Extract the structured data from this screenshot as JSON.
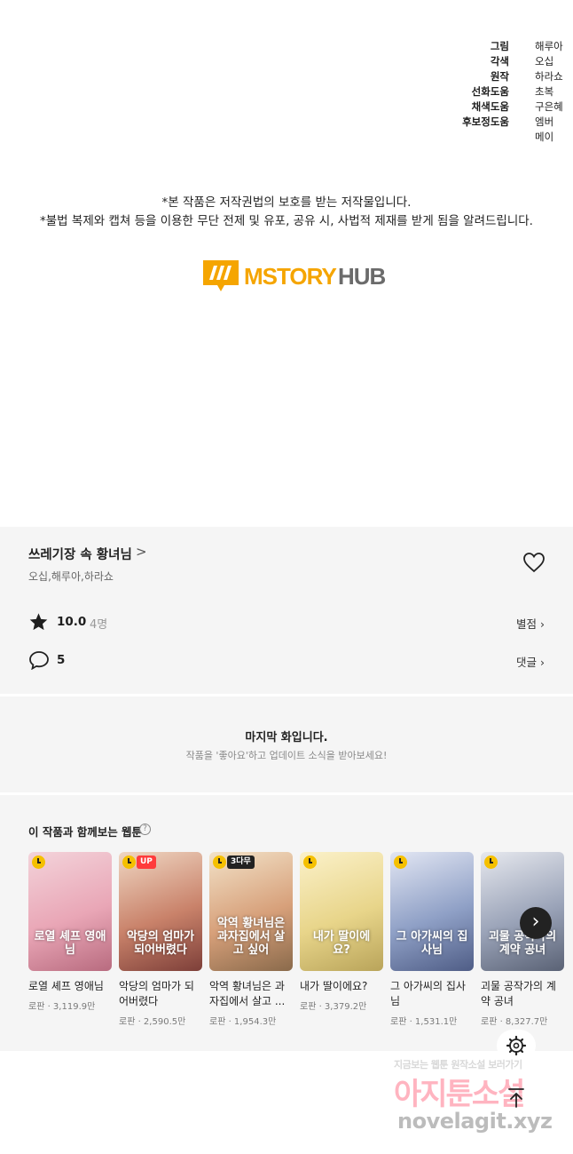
{
  "credits": [
    {
      "role": "그림",
      "name": "해루아"
    },
    {
      "role": "각색",
      "name": "오십"
    },
    {
      "role": "원작",
      "name": "하라쇼"
    },
    {
      "role": "선화도움",
      "name": "초복"
    },
    {
      "role": "채색도움",
      "name": "구은혜"
    },
    {
      "role": "후보정도움",
      "name": "엠버"
    },
    {
      "role": "",
      "name": "메이"
    }
  ],
  "notice": {
    "line1": "*본 작품은 저작권법의 보호를 받는 저작물입니다.",
    "line2": "*불법 복제와 캡쳐 등을 이용한 무단 전제 및 유포, 공유 시, 사법적 제재를 받게 됨을 알려드립니다."
  },
  "logo": {
    "text_main": "MSTORY",
    "text_hub": "HUB",
    "colors": {
      "accent": "#f5a500",
      "text": "#6b6b6b"
    }
  },
  "series": {
    "title": "쓰레기장 속 황녀님",
    "arrow": ">",
    "authors": "오십,해루아,하라쇼",
    "rating": "10.0",
    "rating_count": "4명",
    "rate_label": "별점",
    "comment_count": "5",
    "comment_label": "댓글"
  },
  "last_episode": {
    "title": "마지막 화입니다.",
    "subtitle": "작품을 '좋아요'하고 업데이트 소식을 받아보세요!"
  },
  "recommendations": {
    "title": "이 작품과 함께보는 웹툰",
    "help": "?",
    "items": [
      {
        "title": "로열 셰프 영애님",
        "meta": "로판 · 3,119.9만",
        "badge": "",
        "cover_text": "로열 셰프 영애님",
        "color": "#e9a6b6"
      },
      {
        "title": "악당의 엄마가 되어버렸다",
        "meta": "로판 · 2,590.5만",
        "badge": "UP",
        "cover_text": "악당의 엄마가 되어버렸다",
        "color": "#c9826a"
      },
      {
        "title": "악역 황녀님은 과자집에서 살고 ...",
        "meta": "로판 · 1,954.3만",
        "badge": "3다무",
        "cover_text": "악역 황녀님은 과자집에서 살고 싶어",
        "color": "#d7a07a"
      },
      {
        "title": "내가 딸이에요?",
        "meta": "로판 · 3,379.2만",
        "badge": "",
        "cover_text": "내가 딸이에요?",
        "color": "#e8d58a"
      },
      {
        "title": "그 아가씨의 집사님",
        "meta": "로판 · 1,531.1만",
        "badge": "",
        "cover_text": "그 아가씨의 집사님",
        "color": "#8fa0c6"
      },
      {
        "title": "괴물 공작가의 계약 공녀",
        "meta": "로판 · 8,327.7만",
        "badge": "",
        "cover_text": "괴물 공작가의 계약 공녀",
        "color": "#9aa3b8"
      }
    ]
  },
  "watermark": {
    "line1": "지금보는 웹툰 원작소설 보러가기",
    "line2": "아지툰소설",
    "line3": "novelagit.xyz"
  },
  "icons": {
    "heart": "heart-outline-icon",
    "star": "star-icon",
    "comment": "speech-bubble-icon",
    "next": "chevron-right-icon",
    "settings": "gear-icon",
    "scroll_top": "arrow-up-icon"
  }
}
